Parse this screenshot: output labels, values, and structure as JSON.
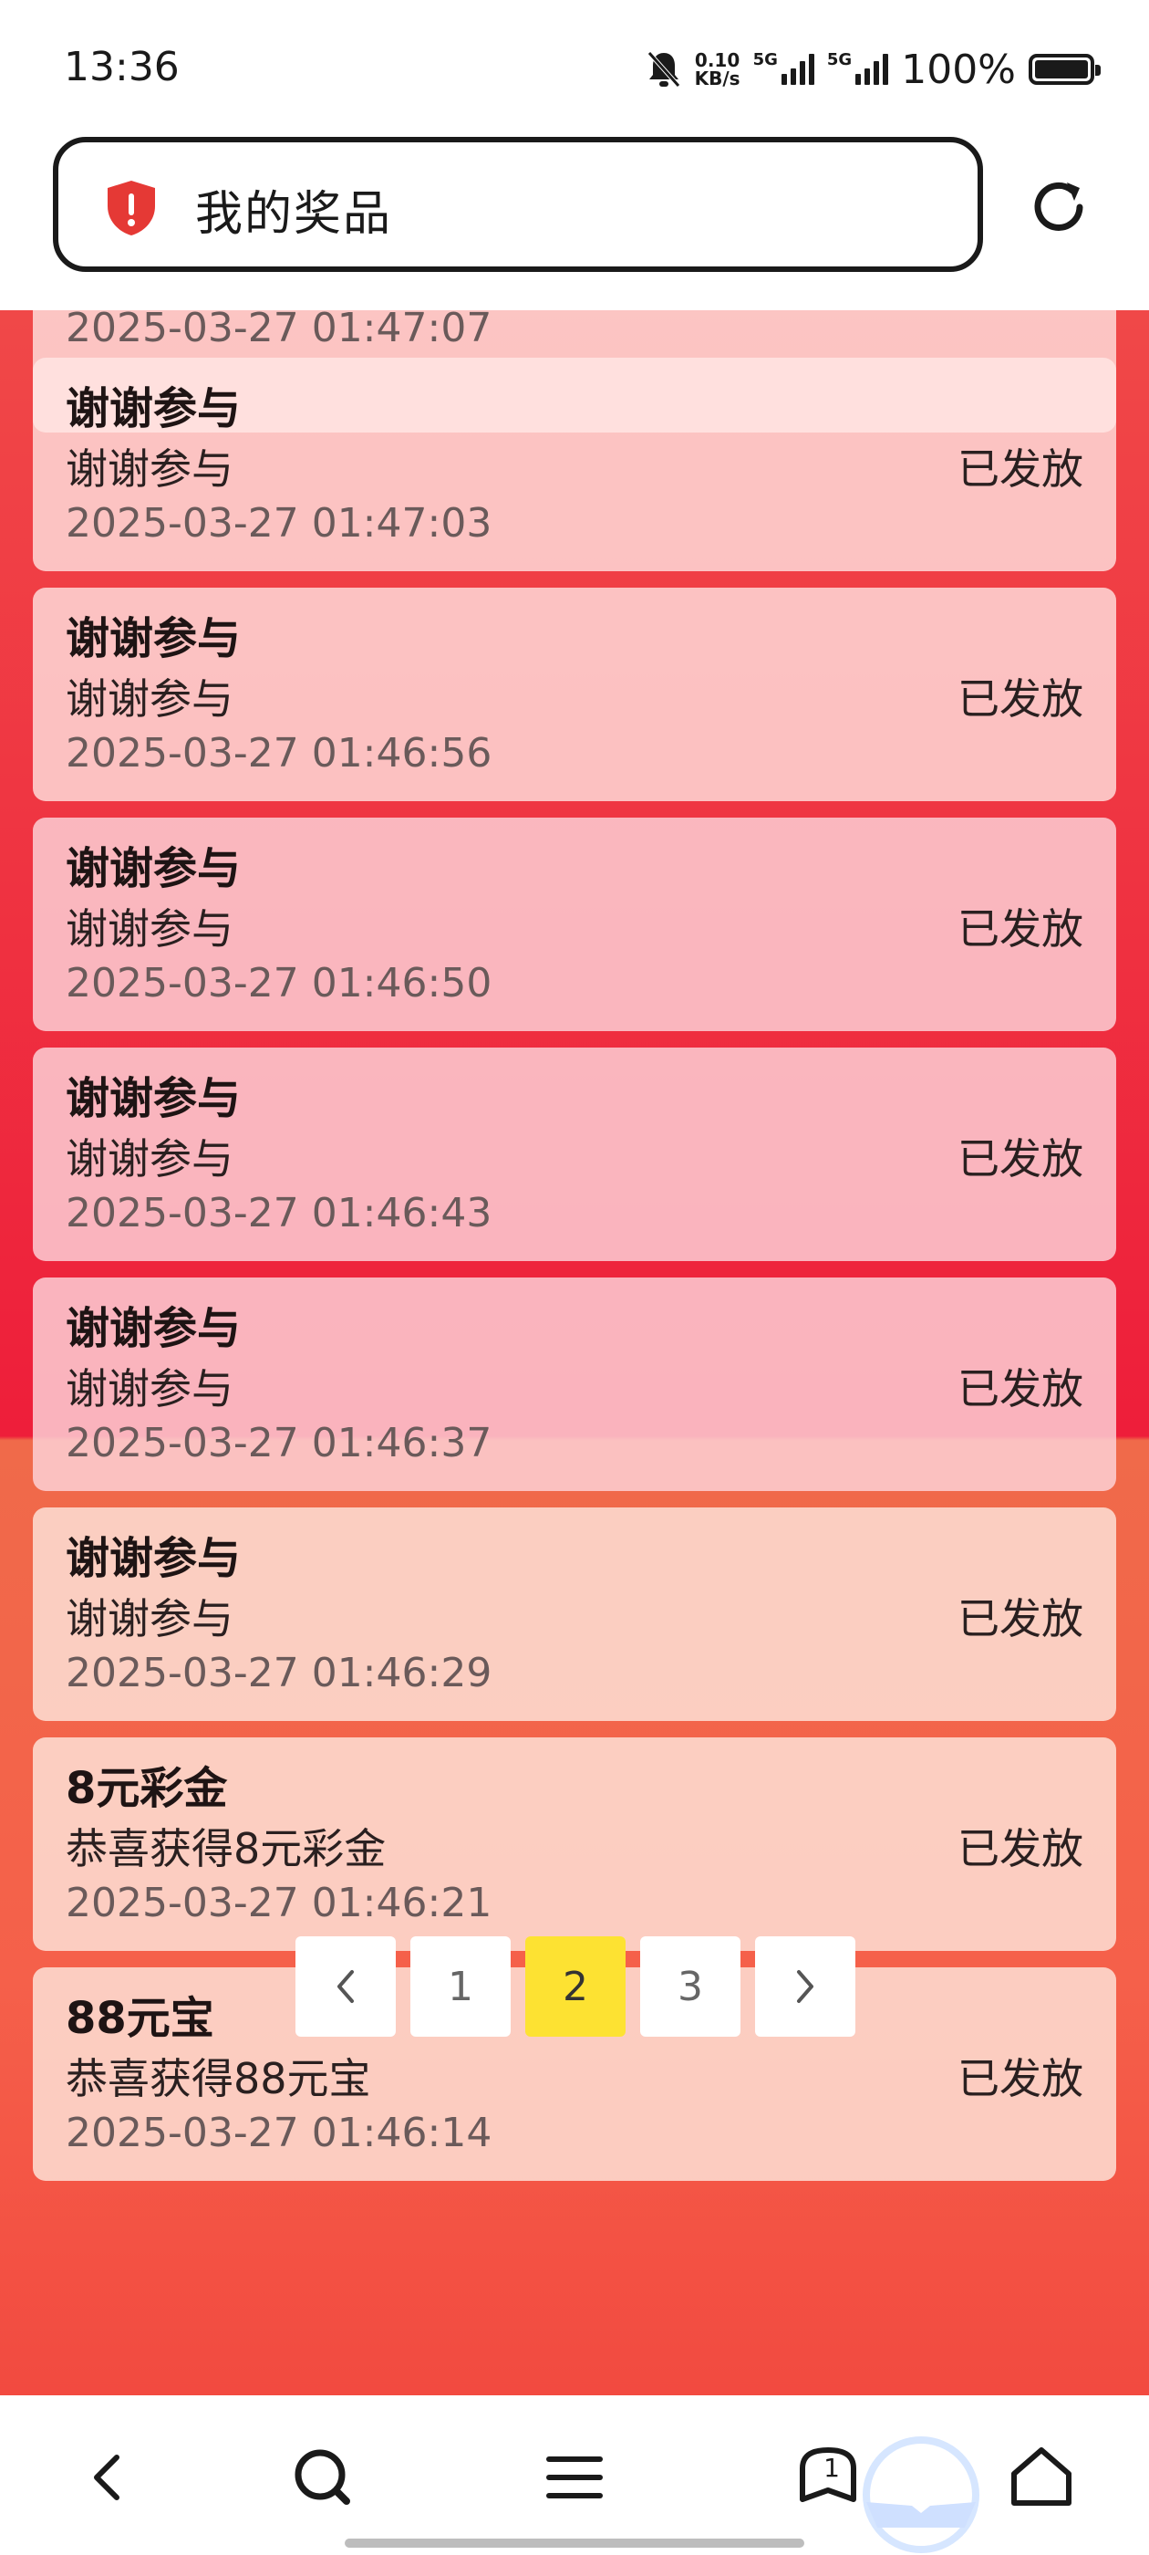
{
  "status_bar": {
    "time": "13:36",
    "net_speed_value": "0.10",
    "net_speed_unit": "KB/s",
    "sim1_label": "5G",
    "sim2_label": "5G",
    "battery_text": "100%",
    "icons": [
      "mute-bell-icon",
      "signal-icon",
      "battery-icon"
    ]
  },
  "address_bar": {
    "title": "我的奖品",
    "shield_color": "#e53935",
    "icons": [
      "shield-warning-icon",
      "refresh-icon"
    ]
  },
  "partial_item": {
    "time": "2025-03-27 01:47:07"
  },
  "prizes": [
    {
      "title": "谢谢参与",
      "desc": "谢谢参与",
      "time": "2025-03-27 01:47:03",
      "status": "已发放"
    },
    {
      "title": "谢谢参与",
      "desc": "谢谢参与",
      "time": "2025-03-27 01:46:56",
      "status": "已发放"
    },
    {
      "title": "谢谢参与",
      "desc": "谢谢参与",
      "time": "2025-03-27 01:46:50",
      "status": "已发放"
    },
    {
      "title": "谢谢参与",
      "desc": "谢谢参与",
      "time": "2025-03-27 01:46:43",
      "status": "已发放"
    },
    {
      "title": "谢谢参与",
      "desc": "谢谢参与",
      "time": "2025-03-27 01:46:37",
      "status": "已发放"
    },
    {
      "title": "谢谢参与",
      "desc": "谢谢参与",
      "time": "2025-03-27 01:46:29",
      "status": "已发放"
    },
    {
      "title": "8元彩金",
      "desc": "恭喜获得8元彩金",
      "time": "2025-03-27 01:46:21",
      "status": "已发放"
    },
    {
      "title": "88元宝",
      "desc": "恭喜获得88元宝",
      "time": "2025-03-27 01:46:14",
      "status": "已发放"
    }
  ],
  "pagination": {
    "prev_icon": "chevron-left-icon",
    "next_icon": "chevron-right-icon",
    "pages": [
      "1",
      "2",
      "3"
    ],
    "active_page": "2",
    "active_color": "#fde232"
  },
  "bottom_nav": {
    "icons": [
      "back-icon",
      "search-icon",
      "menu-icon",
      "tabs-icon",
      "home-icon"
    ],
    "tab_count": "1"
  },
  "colors": {
    "page_red": "#f04848",
    "page_crimson": "#ee1e3a",
    "page_orange": "#f5604a"
  }
}
